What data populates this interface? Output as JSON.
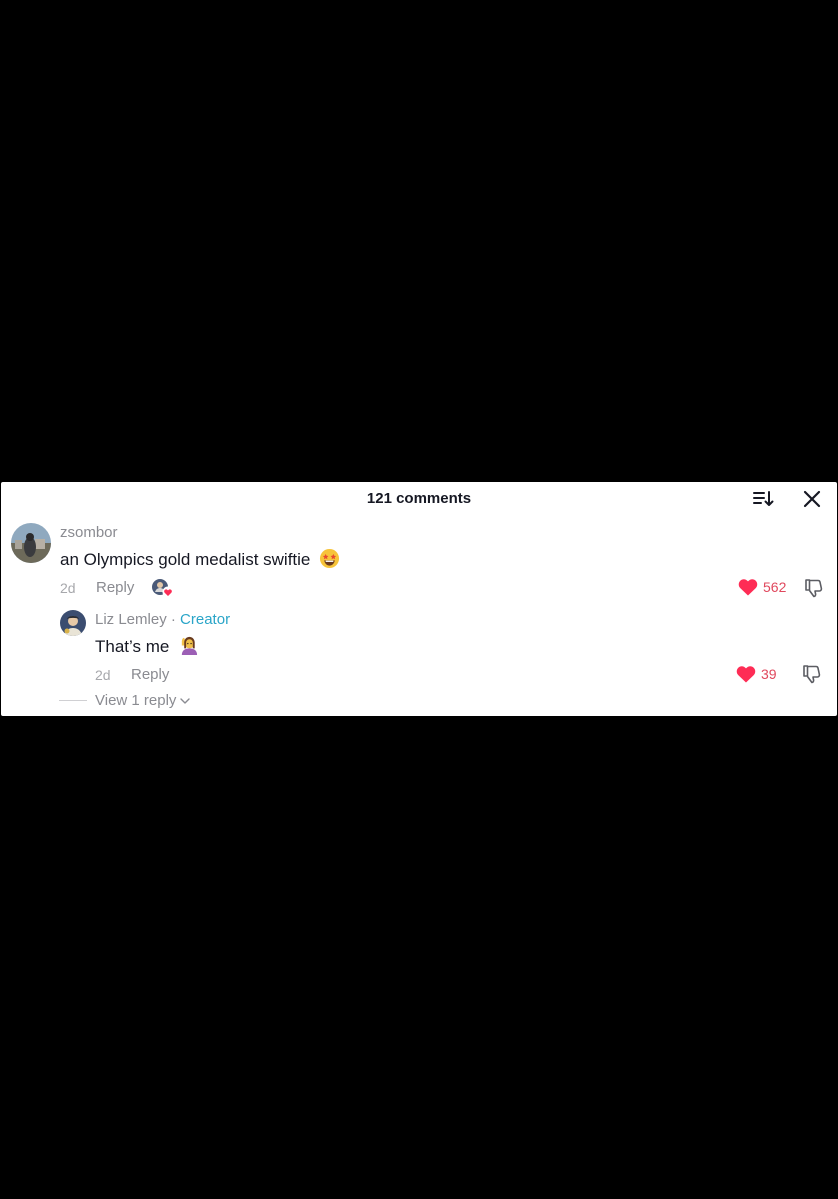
{
  "header": {
    "title": "121 comments",
    "sort_icon": "sort-icon",
    "close_icon": "close-icon"
  },
  "comment": {
    "username": "zsombor",
    "text": "an Olympics gold medalist swiftie",
    "emoji": "star-struck-emoji",
    "time": "2d",
    "reply_label": "Reply",
    "likes": "562"
  },
  "reply": {
    "username": "Liz Lemley",
    "separator": "·",
    "creator_label": "Creator",
    "text": "That’s me",
    "emoji": "raising-hand-emoji",
    "time": "2d",
    "reply_label": "Reply",
    "likes": "39"
  },
  "view_replies": {
    "label": "View 1 reply"
  },
  "colors": {
    "like": "#FE2C55",
    "creator": "#2AA5C8",
    "muted": "#8A8B91"
  }
}
